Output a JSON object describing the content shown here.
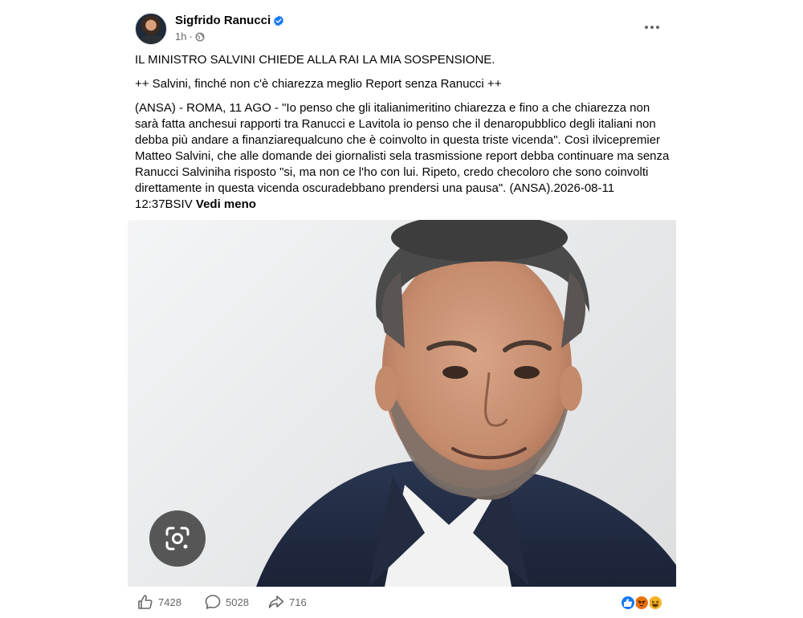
{
  "post": {
    "author": "Sigfrido Ranucci",
    "time": "1h",
    "separator": "·",
    "headline": "IL MINISTRO SALVINI CHIEDE ALLA RAI  LA MIA SOSPENSIONE.",
    "subheadline": "++ Salvini, finché non c'è chiarezza meglio Report senza Ranucci ++",
    "body": "(ANSA) - ROMA, 11 AGO - \"Io penso che gli italianimeritino chiarezza e fino a che chiarezza non sarà fatta anchesui rapporti tra Ranucci e Lavitola io penso che il denaropubblico degli italiani non debba più andare a finanziarequalcuno che è coinvolto in questa triste vicenda\". Così ilvicepremier Matteo Salvini, che alle domande dei giornalisti sela trasmissione report debba continuare ma senza Ranucci Salviniha risposto \"si, ma non ce l'ho con lui. Ripeto, credo checoloro che sono coinvolti direttamente in questa vicenda oscuradebbano prendersi una pausa\". (ANSA).2026-08-11 12:37BSIV",
    "see_less": "Vedi meno"
  },
  "icons": {
    "verified": "verified-badge-icon",
    "audience": "globe-icon",
    "more": "more-options-icon",
    "lens": "google-lens-icon",
    "like": "thumbs-up-icon",
    "comment": "comment-icon",
    "share": "share-icon"
  },
  "stats": {
    "likes": "7428",
    "comments": "5028",
    "shares": "716"
  },
  "reactions": [
    "like",
    "angry",
    "haha"
  ],
  "colors": {
    "verified": "#1877f2",
    "muted_text": "#65676b",
    "like_reaction": "#1877f2",
    "angry_reaction": "#e9710f",
    "haha_reaction": "#f7b125"
  }
}
